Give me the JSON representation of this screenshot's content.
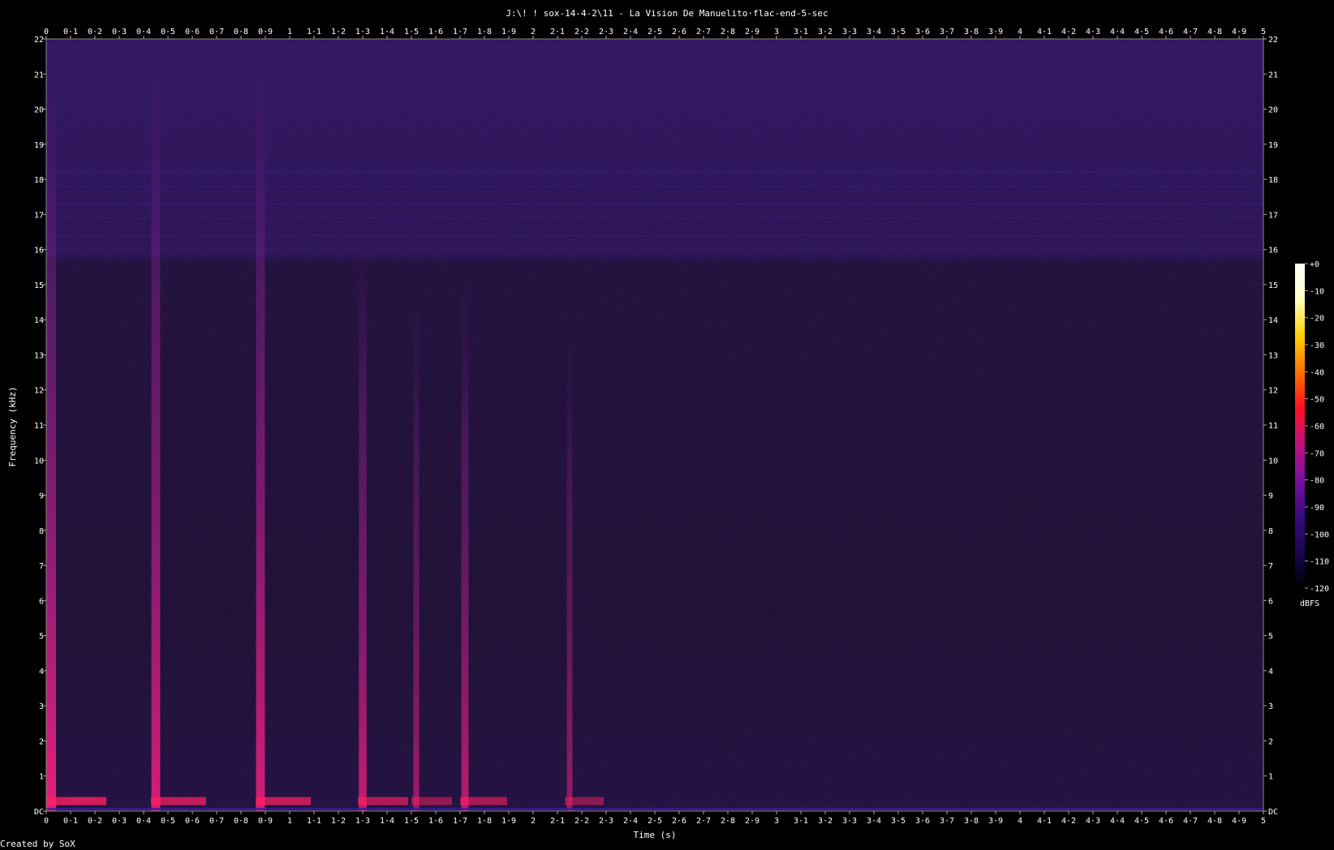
{
  "chart_data": {
    "type": "heatmap",
    "title": "J:\\! ! sox-14-4-2\\11 - La Vision De Manuelito·flac-end-5-sec",
    "xlabel": "Time (s)",
    "ylabel": "Frequency (kHz)",
    "xlim": [
      0,
      5
    ],
    "ylim": [
      0,
      22
    ],
    "x_ticks": [
      "0",
      "0·1",
      "0·2",
      "0·3",
      "0·4",
      "0·5",
      "0·6",
      "0·7",
      "0·8",
      "0·9",
      "1",
      "1·1",
      "1·2",
      "1·3",
      "1·4",
      "1·5",
      "1·6",
      "1·7",
      "1·8",
      "1·9",
      "2",
      "2·1",
      "2·2",
      "2·3",
      "2·4",
      "2·5",
      "2·6",
      "2·7",
      "2·8",
      "2·9",
      "3",
      "3·1",
      "3·2",
      "3·3",
      "3·4",
      "3·5",
      "3·6",
      "3·7",
      "3·8",
      "3·9",
      "4",
      "4·1",
      "4·2",
      "4·3",
      "4·4",
      "4·5",
      "4·6",
      "4·7",
      "4·8",
      "4·9",
      "5"
    ],
    "y_ticks": [
      "DC",
      "1",
      "2",
      "3",
      "4",
      "5",
      "6",
      "7",
      "8",
      "9",
      "10",
      "11",
      "12",
      "13",
      "14",
      "15",
      "16",
      "17",
      "18",
      "19",
      "20",
      "21",
      "22"
    ],
    "colorbar": {
      "label": "dBFS",
      "range": [
        -120,
        0
      ],
      "ticks": [
        "+0",
        "-10",
        "-20",
        "-30",
        "-40",
        "-50",
        "-60",
        "-70",
        "-80",
        "-90",
        "-100",
        "-110",
        "-120"
      ],
      "colors": [
        "#000000",
        "#1a0550",
        "#3a0a80",
        "#7a10a0",
        "#c01080",
        "#ff1020",
        "#ff7000",
        "#ffd000",
        "#ffffc0",
        "#ffffff"
      ]
    },
    "transients": [
      {
        "time": 0.02,
        "max_khz": 21.0,
        "strength": 1.0
      },
      {
        "time": 0.45,
        "max_khz": 21.5,
        "strength": 0.85
      },
      {
        "time": 0.88,
        "max_khz": 21.5,
        "strength": 0.85
      },
      {
        "time": 1.3,
        "max_khz": 16.0,
        "strength": 0.7
      },
      {
        "time": 1.52,
        "max_khz": 14.5,
        "strength": 0.4
      },
      {
        "time": 1.72,
        "max_khz": 14.8,
        "strength": 0.6
      },
      {
        "time": 2.15,
        "max_khz": 13.5,
        "strength": 0.35
      }
    ],
    "grid": false
  },
  "footer": "Created by SoX"
}
